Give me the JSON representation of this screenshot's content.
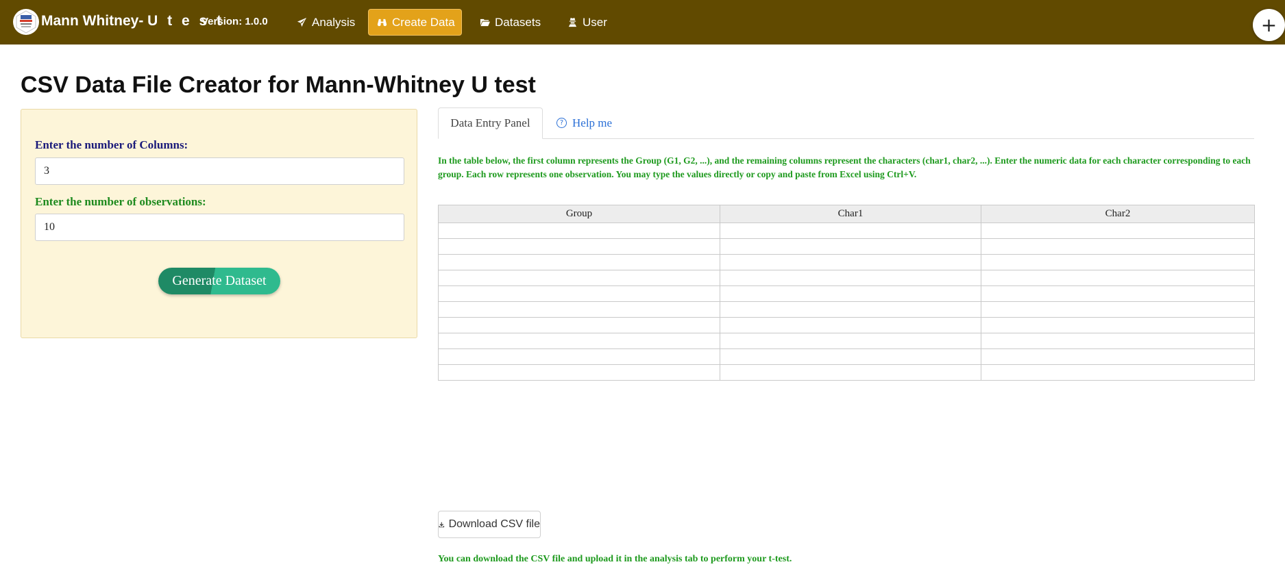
{
  "navbar": {
    "brand_main": "Mann Whitney- ",
    "brand_spaced": "U t e s t",
    "version": "Version: 1.0.0",
    "items": [
      {
        "label": "Analysis",
        "icon": "paper-plane-icon"
      },
      {
        "label": "Create Data",
        "icon": "binoculars-icon",
        "active": true
      },
      {
        "label": "Datasets",
        "icon": "folder-open-icon"
      },
      {
        "label": "User",
        "icon": "user-secret-icon"
      }
    ],
    "plus_label": "+",
    "colors": {
      "bar": "#614a00",
      "active": "#e3a21a"
    }
  },
  "page": {
    "title": "CSV Data File Creator for Mann-Whitney U test"
  },
  "sidebar": {
    "columns_label": "Enter the number of Columns:",
    "columns_value": "3",
    "observations_label": "Enter the number of observations:",
    "observations_value": "10",
    "generate_label": "Generate Dataset"
  },
  "tabs": [
    {
      "label": "Data Entry Panel",
      "active": true
    },
    {
      "label": "Help me",
      "icon": "question-circle-icon"
    }
  ],
  "instructions": "In the table below, the first column represents the Group (G1, G2, ...), and the remaining columns represent the characters (char1, char2, ...). Enter the numeric data for each character corresponding to each group. Each row represents one observation. You may type the values directly or copy and paste from Excel using Ctrl+V.",
  "table": {
    "headers": [
      "Group",
      "Char1",
      "Char2"
    ],
    "rows": [
      [
        "",
        "",
        ""
      ],
      [
        "",
        "",
        ""
      ],
      [
        "",
        "",
        ""
      ],
      [
        "",
        "",
        ""
      ],
      [
        "",
        "",
        ""
      ],
      [
        "",
        "",
        ""
      ],
      [
        "",
        "",
        ""
      ],
      [
        "",
        "",
        ""
      ],
      [
        "",
        "",
        ""
      ],
      [
        "",
        "",
        ""
      ]
    ]
  },
  "download": {
    "label": "Download CSV file",
    "note": "You can download the CSV file and upload it in the analysis tab to perform your t-test."
  }
}
